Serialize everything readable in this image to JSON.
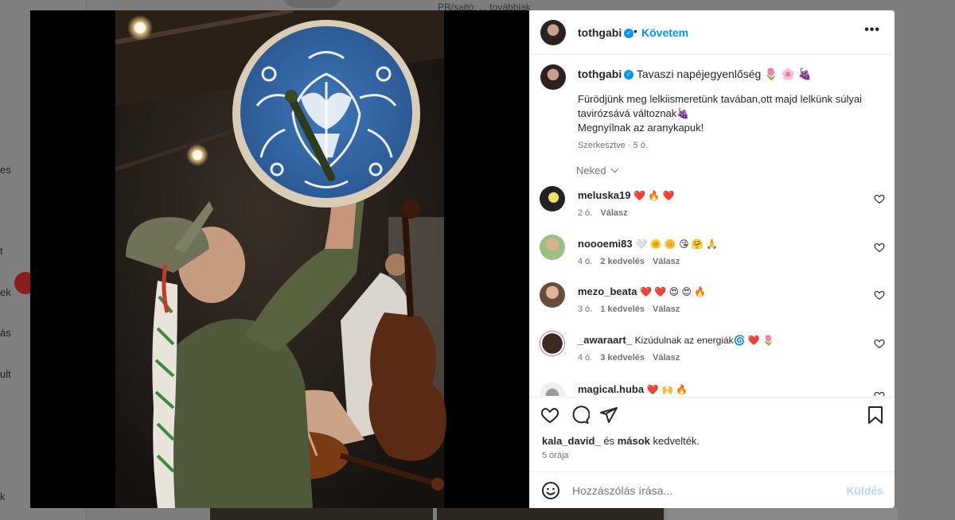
{
  "background": {
    "sidebar_fragments": [
      "es",
      "t",
      "ek",
      "ás",
      "ult",
      "k"
    ],
    "top_text": "PR/sajtó: ... továbbiak"
  },
  "post": {
    "author": "tothgabi",
    "follow_label": "Követem",
    "separator": "•",
    "more_label": "•••",
    "caption_title": "Tavaszi napéjegyenlőség 🌷 🌸 🍇",
    "caption_line1": "Fürödjünk meg lelkiismeretünk tavában,ott majd lelkünk súlyai tavirózsává változnak🍇",
    "caption_line2": "Megnyílnak az aranykapuk!",
    "caption_meta": "Szerkesztve · 5 ó.",
    "sort_label": "Neked",
    "comments": [
      {
        "user": "meluska19",
        "text": "❤️ 🔥 ❤️",
        "age": "2 ó.",
        "likes": "",
        "reply": "Válasz"
      },
      {
        "user": "noooemi83",
        "text": "🤍 🌞 🌼 😘 🤗 🙏",
        "age": "4 ó.",
        "likes": "2 kedvelés",
        "reply": "Válasz"
      },
      {
        "user": "mezo_beata",
        "text": "❤️ ❤️ 😍 😍 🔥",
        "age": "3 ó.",
        "likes": "1 kedvelés",
        "reply": "Válasz"
      },
      {
        "user": "_awaraart_",
        "text": "Kizúdulnak az energiák🌀 ❤️ 🌷",
        "age": "4 ó.",
        "likes": "3 kedvelés",
        "reply": "Válasz"
      },
      {
        "user": "magical.huba",
        "text": "❤️ 🙌 🔥",
        "age": "",
        "likes": "",
        "reply": ""
      }
    ],
    "liked_by_user": "kala_david_",
    "liked_by_mid": " és ",
    "liked_by_others": "mások",
    "liked_by_suffix": " kedvelték.",
    "post_age": "5 órája",
    "comment_placeholder": "Hozzászólás írása...",
    "post_button": "Küldés"
  },
  "colors": {
    "accent": "#0095f6",
    "text": "#262626",
    "muted": "#737373"
  }
}
